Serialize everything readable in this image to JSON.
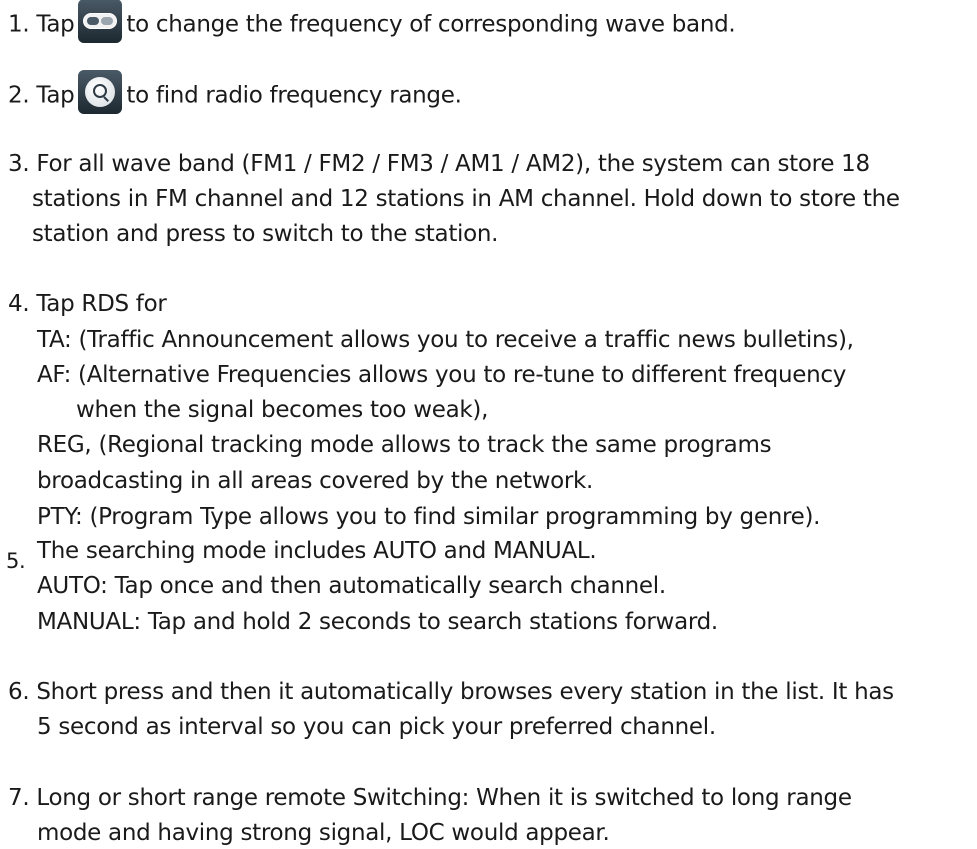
{
  "item1": {
    "number": "1.",
    "before": "Tap",
    "after": "to change the frequency of corresponding wave band."
  },
  "item2": {
    "number": "2.",
    "before": "Tap",
    "after": "to find radio frequency range."
  },
  "item3": {
    "lines": [
      "3.  For all wave band (FM1 / FM2 / FM3 / AM1 / AM2), the system can store 18",
      "stations in FM channel and 12 stations in AM channel. Hold down to store the",
      "station and press to switch to the station."
    ]
  },
  "item4": {
    "lines": [
      "4.  Tap RDS for",
      "TA: (Traffic Announcement allows you to receive a traffic news bulletins),",
      "AF: (Alternative Frequencies allows you to re-tune to different frequency",
      "when the signal becomes too weak),",
      "REG, (Regional tracking mode allows to track the same programs",
      "broadcasting in all areas covered by the network.",
      "PTY: (Program Type allows you to find similar programming by genre)."
    ]
  },
  "item5": {
    "number": "5.",
    "lines": [
      "The searching mode includes AUTO and MANUAL.",
      "AUTO: Tap once and then automatically search channel.",
      "MANUAL: Tap and hold 2 seconds to search stations forward."
    ]
  },
  "item6": {
    "lines": [
      "6.  Short press and then it automatically browses every station in the list. It has",
      "5 second as interval so you can pick your preferred channel."
    ]
  },
  "item7": {
    "lines": [
      "7.  Long or short range remote Switching: When it is switched to long range",
      "mode and having strong signal, LOC would appear."
    ]
  },
  "icons": {
    "fmam": "fm-am-toggle-icon",
    "search": "search-icon"
  }
}
